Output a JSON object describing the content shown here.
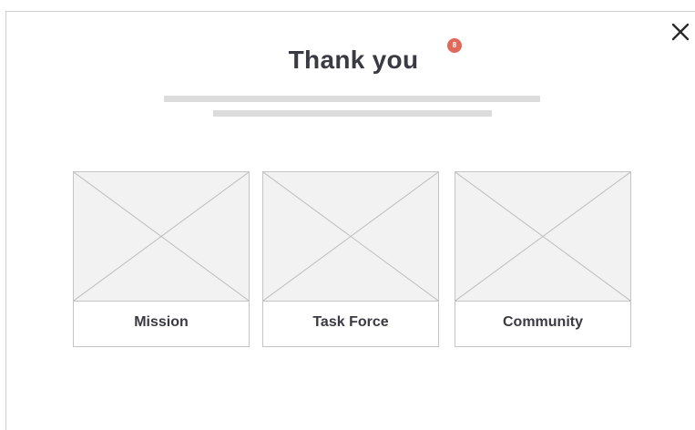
{
  "modal": {
    "title": "Thank you",
    "notification_count": "8",
    "close_icon": "close-icon"
  },
  "cards": [
    {
      "label": "Mission",
      "image_icon": "image-placeholder-icon"
    },
    {
      "label": "Task Force",
      "image_icon": "image-placeholder-icon"
    },
    {
      "label": "Community",
      "image_icon": "image-placeholder-icon"
    }
  ],
  "colors": {
    "title_text": "#3a3a42",
    "badge_background": "#e2695a",
    "placeholder_line": "#dcdcdc",
    "image_placeholder": "#f2f2f2"
  }
}
